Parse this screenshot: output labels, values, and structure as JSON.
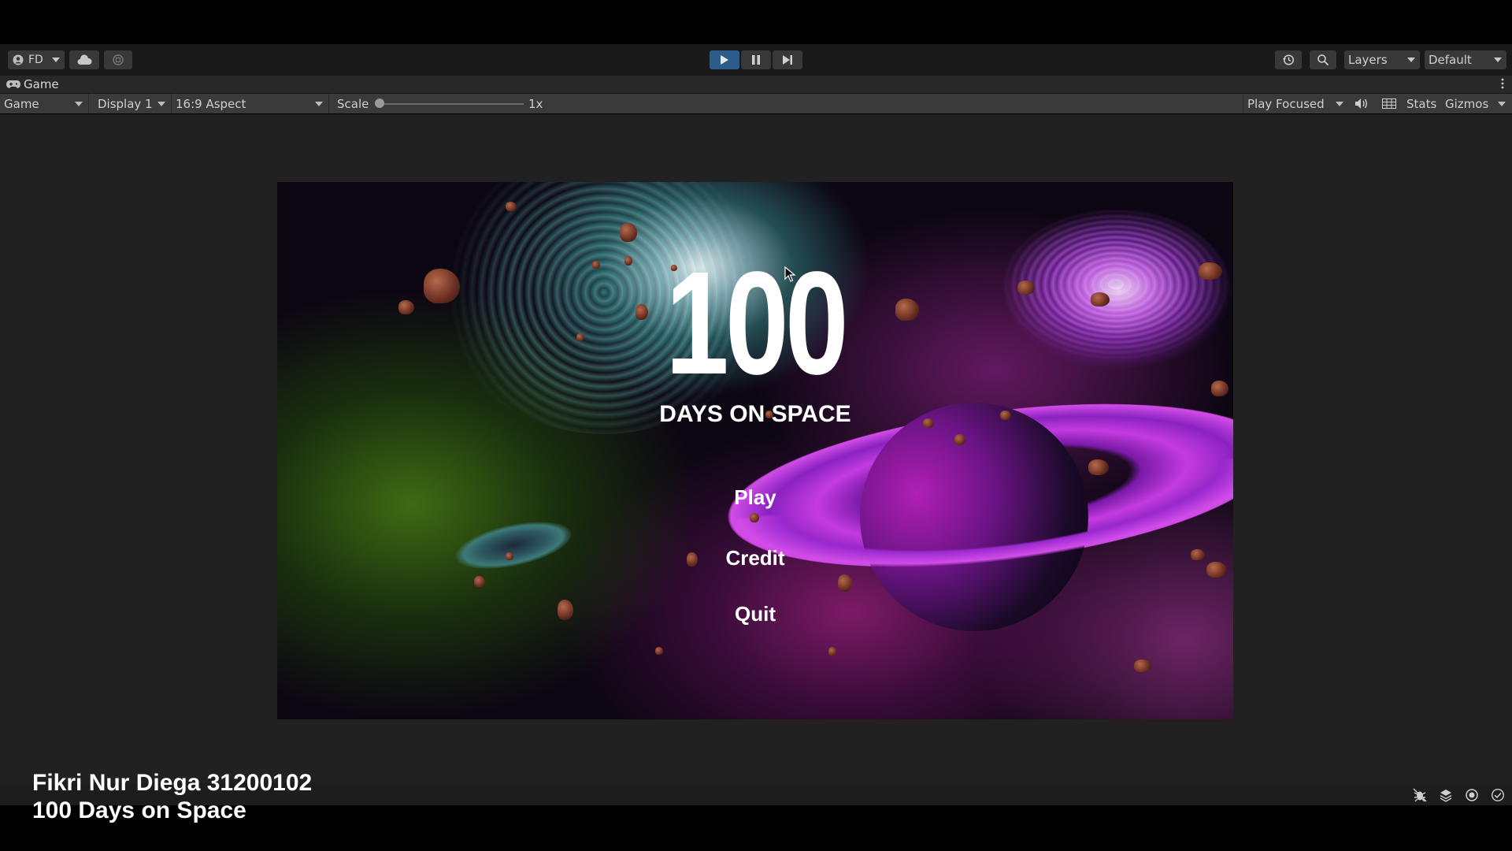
{
  "toolbar": {
    "account_label": "FD",
    "layers_label": "Layers",
    "layout_label": "Default",
    "icons": [
      "account-icon",
      "cloud-icon",
      "collab-icon",
      "play-icon",
      "pause-icon",
      "step-icon",
      "history-icon",
      "search-icon"
    ],
    "play_active_color": "#2b5c8a"
  },
  "tab": {
    "label": "Game",
    "icon": "gamepad-icon"
  },
  "game_view_toolbar": {
    "view_mode": "Game",
    "display": "Display 1",
    "aspect": "16:9 Aspect",
    "scale_label": "Scale",
    "scale_value": "1x",
    "scale_fraction": 0.0,
    "play_mode": "Play Focused",
    "stats_label": "Stats",
    "gizmos_label": "Gizmos",
    "icons": [
      "audio-icon",
      "grid-icon"
    ]
  },
  "game": {
    "title_number": "100",
    "title_subtitle": "DAYS ON SPACE",
    "menu": {
      "play": "Play",
      "credit": "Credit",
      "quit": "Quit"
    }
  },
  "status_bar": {
    "icons": [
      "bug-icon",
      "layers-stack-icon",
      "lighting-icon",
      "check-icon"
    ]
  },
  "caption": {
    "line1": "Fikri Nur Diega 31200102",
    "line2": "100 Days on Space"
  }
}
